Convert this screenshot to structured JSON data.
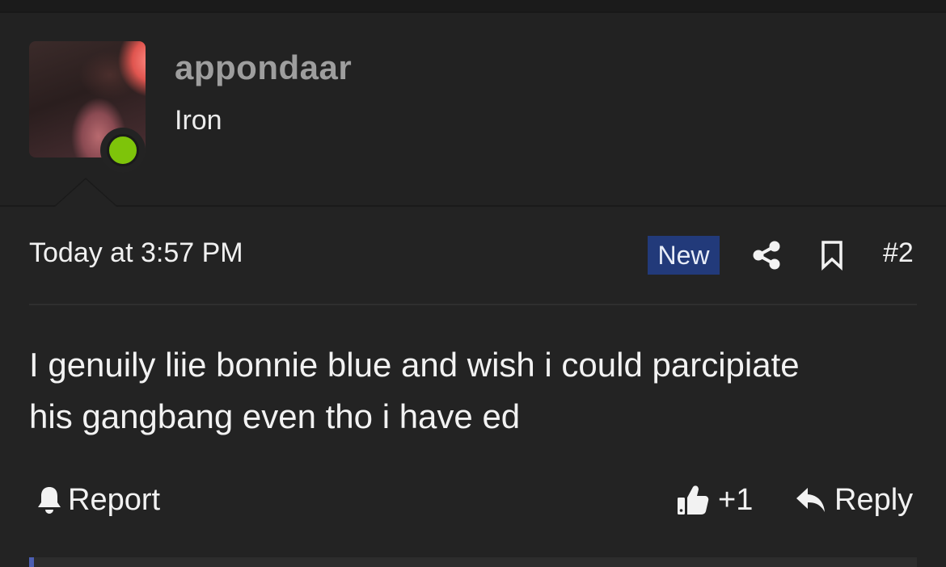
{
  "user": {
    "username": "appondaar",
    "title": "Iron",
    "online": true
  },
  "post": {
    "date": "Today at 3:57 PM",
    "badge": "New",
    "number": "#2",
    "body_line1": "I genuily liie bonnie blue and wish i could parcipiate",
    "body_line2": "his gangbang even tho i have ed"
  },
  "actions": {
    "report_label": "Report",
    "like_count": "+1",
    "reply_label": "Reply"
  },
  "icons": [
    "bell-icon",
    "share-icon",
    "bookmark-icon",
    "thumbs-up-icon",
    "reply-arrow-icon"
  ],
  "colors": {
    "background": "#232323",
    "badge_bg": "#223a7a",
    "online": "#7ec40a",
    "username": "#9e9e9e"
  }
}
